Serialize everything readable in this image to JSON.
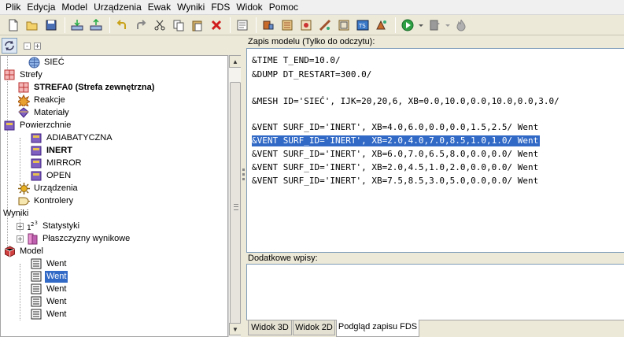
{
  "menu": [
    "Plik",
    "Edycja",
    "Model",
    "Urządzenia",
    "Ewak",
    "Wyniki",
    "FDS",
    "Widok",
    "Pomoc"
  ],
  "toolbar_icons": [
    "new-file-icon",
    "open-folder-icon",
    "save-icon",
    "import-icon",
    "export-icon",
    "undo-icon",
    "redo-icon",
    "cut-icon",
    "copy-icon",
    "paste-icon",
    "delete-icon",
    "notes-icon",
    "tool-a-icon",
    "tool-b-icon",
    "tool-c-icon",
    "tool-d-icon",
    "tool-e-icon",
    "tool-f-icon",
    "tool-g-icon",
    "run-icon",
    "stop-icon",
    "fire-icon"
  ],
  "tree_toolbar": {
    "expand_all": "-",
    "collapse_all": "+"
  },
  "tree": {
    "mesh": "SIEĆ",
    "zones": "Strefy",
    "zone0": "STREFA0 (Strefa zewnętrzna)",
    "reactions": "Reakcje",
    "materials": "Materiały",
    "surfaces": "Powierzchnie",
    "surf_adiabatic": "ADIABATYCZNA",
    "surf_inert": "INERT",
    "surf_mirror": "MIRROR",
    "surf_open": "OPEN",
    "devices": "Urządzenia",
    "controllers": "Kontrolery",
    "results": "Wyniki",
    "statistics": "Statystyki",
    "slices": "Płaszczyzny wynikowe",
    "model": "Model",
    "model_items": [
      "Went",
      "Went",
      "Went",
      "Went",
      "Went"
    ]
  },
  "code_panel": {
    "label": "Zapis modelu (Tylko do odczytu):",
    "lines": [
      "&TIME T_END=10.0/",
      "&DUMP DT_RESTART=300.0/",
      "",
      "&MESH ID='SIEĆ', IJK=20,20,6, XB=0.0,10.0,0.0,10.0,0.0,3.0/",
      "",
      "&VENT SURF_ID='INERT', XB=4.0,6.0,0.0,0.0,1.5,2.5/ Went",
      "&VENT SURF_ID='INERT', XB=2.0,4.0,7.0,8.5,1.0,1.0/ Went",
      "&VENT SURF_ID='INERT', XB=6.0,7.0,6.5,8.0,0.0,0.0/ Went",
      "&VENT SURF_ID='INERT', XB=2.0,4.5,1.0,2.0,0.0,0.0/ Went",
      "&VENT SURF_ID='INERT', XB=7.5,8.5,3.0,5.0,0.0,0.0/ Went"
    ]
  },
  "extra_panel": {
    "label": "Dodatkowe wpisy:"
  },
  "tabs": [
    "Widok 3D",
    "Widok 2D",
    "Podgląd zapisu FDS"
  ]
}
